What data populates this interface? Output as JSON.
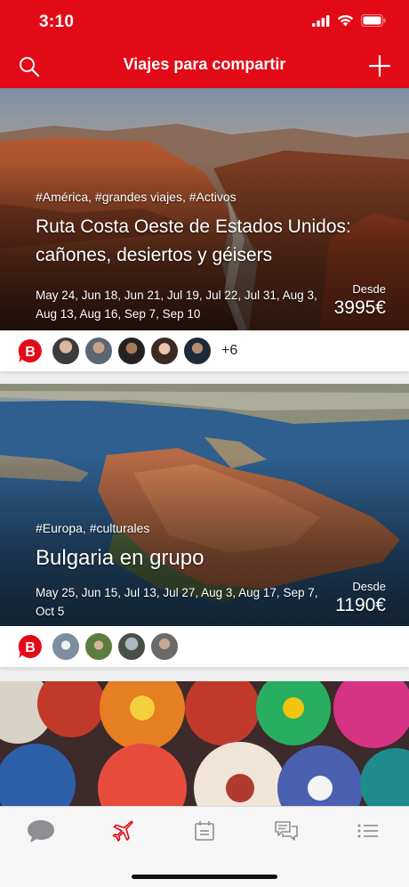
{
  "status_bar": {
    "time": "3:10"
  },
  "nav": {
    "title": "Viajes para compartir",
    "search_icon": "search-icon",
    "add_icon": "plus-icon"
  },
  "colors": {
    "brand": "#e30a17",
    "tab_active": "#e30a17",
    "tab_inactive": "#8e8e93"
  },
  "trips": [
    {
      "tags": "#América, #grandes viajes, #Activos",
      "title": "Ruta Costa Oeste de Estados Unidos: cañones, desiertos y géisers",
      "dates": "May 24, Jun 18, Jun 21, Jul 19, Jul 22, Jul 31, Aug 3, Aug 13, Aug 16, Sep 7, Sep 10",
      "price_label": "Desde",
      "price": "3995€",
      "more_count": "+6"
    },
    {
      "tags": "#Europa, #culturales",
      "title": "Bulgaria en grupo",
      "dates": "May 25, Jun 15, Jul 13, Jul 27, Aug 3, Aug 17, Sep 7, Oct 5",
      "price_label": "Desde",
      "price": "1190€",
      "more_count": ""
    }
  ],
  "tabbar": {
    "tabs": [
      {
        "icon": "chat-bubble-icon",
        "active": false
      },
      {
        "icon": "airplane-icon",
        "active": true
      },
      {
        "icon": "calendar-icon",
        "active": false
      },
      {
        "icon": "messages-icon",
        "active": false
      },
      {
        "icon": "list-icon",
        "active": false
      }
    ]
  }
}
